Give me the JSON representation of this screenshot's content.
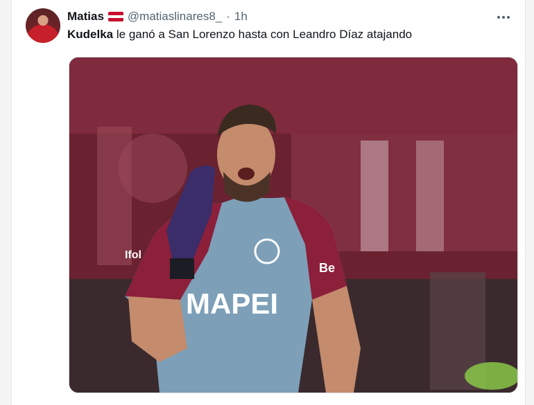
{
  "tweet": {
    "author_name": "Matias",
    "author_handle": "@matiaslinares8_",
    "separator": "·",
    "time": "1h",
    "more_icon": "more-horizontal-icon",
    "text_bold": "Kudelka",
    "text_rest": " le ganó a San Lorenzo hasta con Leandro Díaz atajando",
    "flag_colors": [
      "#75aadb",
      "#ffffff",
      "#75aadb"
    ],
    "image": {
      "jersey_sponsor": "MAPEI",
      "sleeve_text": "Be",
      "chest_text": "Ifol"
    }
  }
}
